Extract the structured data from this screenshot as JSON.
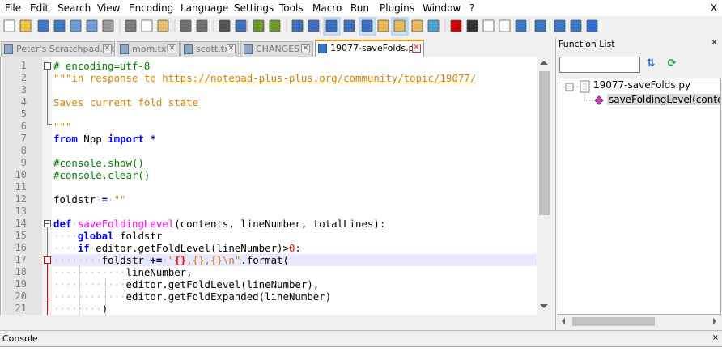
{
  "menu": [
    "File",
    "Edit",
    "Search",
    "View",
    "Encoding",
    "Language",
    "Settings",
    "Tools",
    "Macro",
    "Run",
    "Plugins",
    "Window",
    "?"
  ],
  "menu_close": "X",
  "toolbar_icons": [
    "new-file-icon",
    "open-file-icon",
    "save-icon",
    "save-all-icon",
    "close-icon",
    "close-all-icon",
    "print-icon",
    "cut-icon",
    "copy-icon",
    "paste-icon",
    "undo-icon",
    "redo-icon",
    "find-icon",
    "replace-icon",
    "zoom-in-icon",
    "zoom-out-icon",
    "sync-vertical-icon",
    "sync-horizontal-icon",
    "word-wrap-icon",
    "show-all-chars-icon",
    "indent-guide-icon",
    "doc-map-icon",
    "function-list-icon",
    "folder-workspace-icon",
    "monitor-icon",
    "record-macro-icon",
    "stop-record-icon",
    "play-macro-icon",
    "play-multiple-icon",
    "save-macro-icon",
    "python-run-icon",
    "panel-icon",
    "panel2-icon",
    "panel3-icon"
  ],
  "tabs": [
    {
      "label": "Peter's Scratchpad.txt",
      "active": false
    },
    {
      "label": "mom.txt",
      "active": false
    },
    {
      "label": "scott.txt",
      "active": false
    },
    {
      "label": "CHANGES",
      "active": false
    },
    {
      "label": "19077-saveFolds.py",
      "active": true
    }
  ],
  "tab_close_glyph": "✕",
  "line_numbers": [
    "1",
    "2",
    "3",
    "4",
    "5",
    "6",
    "7",
    "8",
    "9",
    "10",
    "11",
    "12",
    "13",
    "14",
    "15",
    "16",
    "17",
    "18",
    "19",
    "20",
    "21"
  ],
  "current_line": "17",
  "code": {
    "l1": "# encoding=utf-8",
    "l2_quote": "\"\"\"in response to ",
    "l2_link": "https://notepad-plus-plus.org/community/topic/19077/",
    "l4": "Saves current fold state",
    "l6": "\"\"\"",
    "l7_from": "from",
    "l7_mod": " Npp ",
    "l7_import": "import",
    "l7_star": " *",
    "l9": "#console.show()",
    "l10": "#console.clear()",
    "l12_var": "foldstr",
    "l12_eq": "=",
    "l12_str": "\"\"",
    "l14_def": "def",
    "l14_name": "saveFoldingLevel",
    "l14_args": "(contents, lineNumber, totalLines):",
    "l15_global": "global",
    "l15_var": "foldstr",
    "l16_if": "if",
    "l16_expr": "editor.getFoldLevel(lineNumber)>",
    "l16_num": "0",
    "l16_colon": ":",
    "l17_var": "foldstr",
    "l17_op": "+=",
    "l17_str1": "\"",
    "l17_braces": "{}",
    "l17_str2": ",{},{}\\n\"",
    "l17_fmt": ".format(",
    "l18": "lineNumber,",
    "l19": "editor.getFoldLevel(lineNumber),",
    "l20": "editor.getFoldExpanded(lineNumber)",
    "l21": ")"
  },
  "function_list": {
    "title": "Function List",
    "close": "×",
    "search_value": "",
    "root": "19077-saveFolds.py",
    "child": "saveFoldingLevel(contents,"
  },
  "console": {
    "title": "Console",
    "close": "×"
  },
  "colors": {
    "comment": "#008000",
    "string": "#d98000",
    "keyword": "#0000ff",
    "function_name": "#ff00ff",
    "active_tab_accent": "#fa8f00",
    "current_line_bg": "#e8e8ff"
  }
}
